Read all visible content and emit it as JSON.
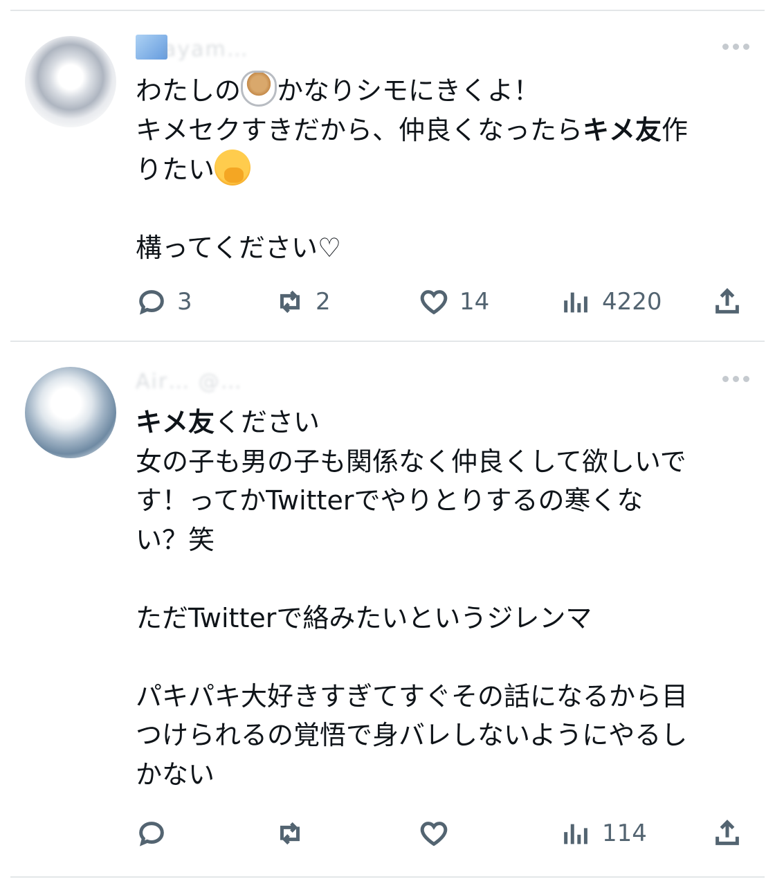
{
  "tweets": [
    {
      "header_name": "ayam…",
      "body_segments": [
        {
          "text": "わたしの",
          "bold": false
        },
        {
          "emoji": "shaved-ice-icon"
        },
        {
          "text": "かなりシモにきくよ！\nキメセクすきだから、仲良くなったら",
          "bold": false
        },
        {
          "text": "キメ友",
          "bold": true
        },
        {
          "text": "作\nりたい",
          "bold": false
        },
        {
          "emoji": "face-with-hand-over-mouth-icon"
        },
        {
          "text": "\n\n構ってください♡",
          "bold": false
        }
      ],
      "actions": {
        "reply_count": "3",
        "retweet_count": "2",
        "like_count": "14",
        "view_count": "4220"
      }
    },
    {
      "header_name": "Air… @…",
      "body_segments": [
        {
          "text": "キメ友",
          "bold": true
        },
        {
          "text": "ください\n女の子も男の子も関係なく仲良くして欲しいで\nす！ってかTwitterでやりとりするの寒くな\nい？笑\n\nただTwitterで絡みたいというジレンマ\n\nパキパキ大好きすぎてすぐその話になるから目\nつけられるの覚悟で身バレしないようにやるし\nかない",
          "bold": false
        }
      ],
      "actions": {
        "reply_count": "",
        "retweet_count": "",
        "like_count": "",
        "view_count": "114"
      }
    }
  ],
  "colors": {
    "text": "#0f1419",
    "secondary": "#536471",
    "divider": "#e3e6e8"
  }
}
